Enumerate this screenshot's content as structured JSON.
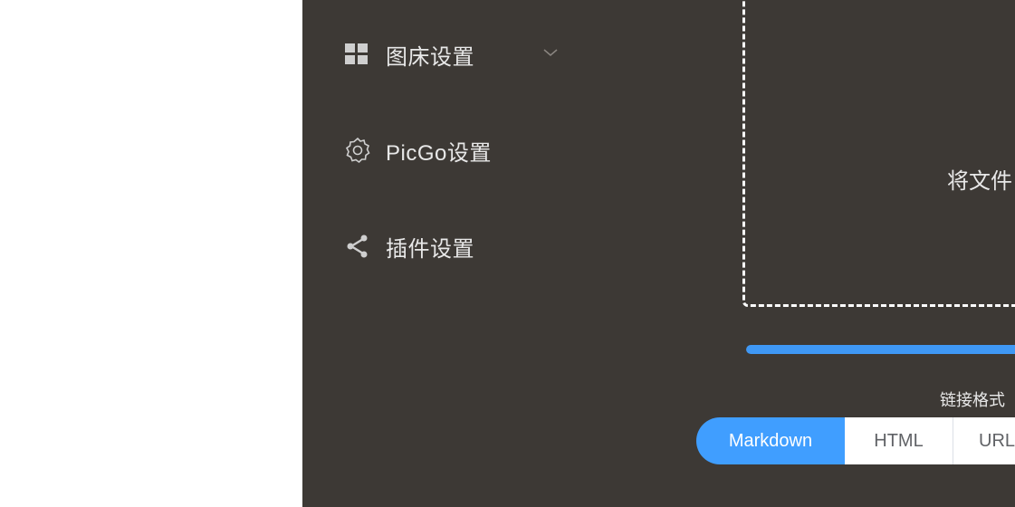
{
  "sidebar": {
    "items": [
      {
        "label": "图床设置",
        "icon": "grid-icon",
        "has_chevron": true
      },
      {
        "label": "PicGo设置",
        "icon": "gear-icon"
      },
      {
        "label": "插件设置",
        "icon": "share-icon"
      }
    ]
  },
  "upload": {
    "drop_text": "将文件",
    "progress_percent": 100
  },
  "link_format": {
    "label": "链接格式",
    "options": [
      "Markdown",
      "HTML",
      "URL"
    ],
    "selected": "Markdown"
  },
  "colors": {
    "background": "#3d3935",
    "accent": "#409eff",
    "text": "#e8e8e8"
  }
}
